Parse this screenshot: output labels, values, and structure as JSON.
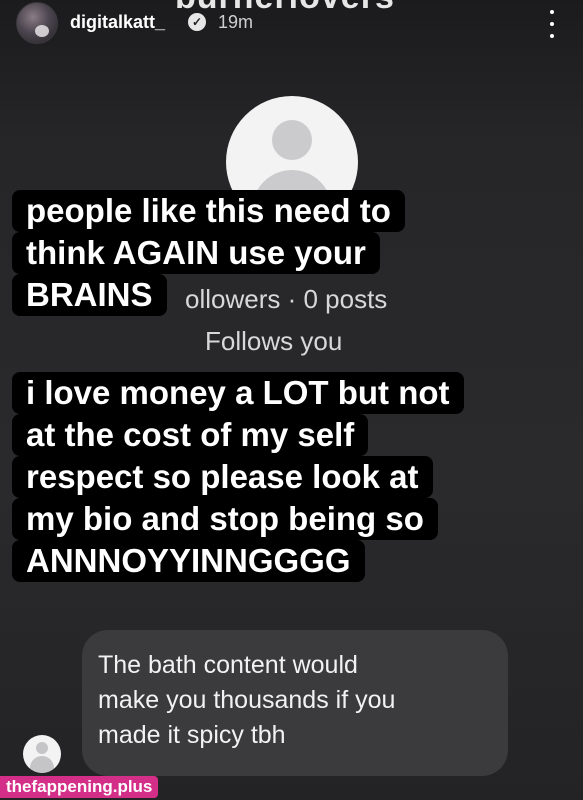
{
  "header": {
    "top_partial_text": "burnerlovers",
    "username": "digitalkatt_",
    "verified_icon": "verified-badge-icon",
    "timestamp": "19m",
    "more_icon": "more-vertical-icon"
  },
  "profile": {
    "followers_text": "ollowers · 0 posts",
    "follows_you": "Follows you"
  },
  "captions": {
    "caption1": [
      "people like this need to",
      "think AGAIN use your",
      "BRAINS"
    ],
    "caption2": [
      "i love money a LOT but not",
      "at the cost of my self",
      "respect so please look at",
      "my bio and stop being so",
      "ANNNOYYINNGGGG"
    ]
  },
  "message": {
    "lines": [
      "The bath content would",
      "make you thousands if you",
      "made it spicy tbh"
    ]
  },
  "watermark": "thefappening.plus",
  "colors": {
    "background": "#272729",
    "caption_bg": "#000000",
    "bubble_bg": "#3b3b3d",
    "watermark_bg": "#d42f88"
  }
}
